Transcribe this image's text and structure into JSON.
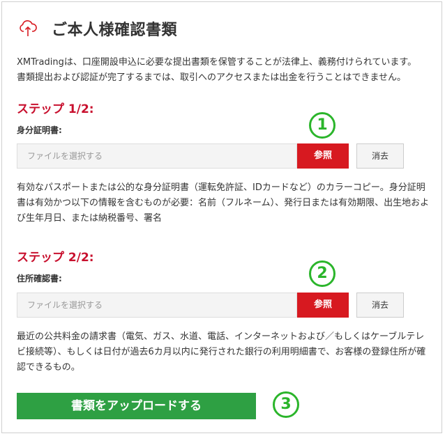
{
  "header": {
    "title": "ご本人様確認書類",
    "icon": "cloud-upload-icon",
    "icon_color": "#d71920"
  },
  "intro": {
    "line1": "XMTradingは、口座開設申込に必要な提出書類を保管することが法律上、義務付けられています。",
    "line2": "書類提出および認証が完了するまでは、取引へのアクセスまたは出金を行うことはできません。"
  },
  "step1": {
    "heading": "ステップ 1/2:",
    "label": "身分証明書:",
    "input_placeholder": "ファイルを選択する",
    "browse_label": "参照",
    "clear_label": "消去",
    "description": "有効なパスポートまたは公的な身分証明書（運転免許証、IDカードなど）のカラーコピー。身分証明書は有効かつ以下の情報を含むものが必要：名前（フルネーム）、発行日または有効期限、出生地および生年月日、または納税番号、署名"
  },
  "step2": {
    "heading": "ステップ 2/2:",
    "label": "住所確認書:",
    "input_placeholder": "ファイルを選択する",
    "browse_label": "参照",
    "clear_label": "消去",
    "description": "最近の公共料金の請求書（電気、ガス、水道、電話、インターネットおよび／もしくはケーブルテレビ接続等）、もしくは日付が過去6カ月以内に発行された銀行の利用明細書で、お客様の登録住所が確認できるもの。"
  },
  "upload_button": {
    "label": "書類をアップロードする"
  },
  "markers": [
    "1",
    "2",
    "3"
  ],
  "colors": {
    "accent_red": "#d71920",
    "heading_red": "#c8102e",
    "upload_green": "#2ea043",
    "marker_green": "#2bb52b"
  }
}
